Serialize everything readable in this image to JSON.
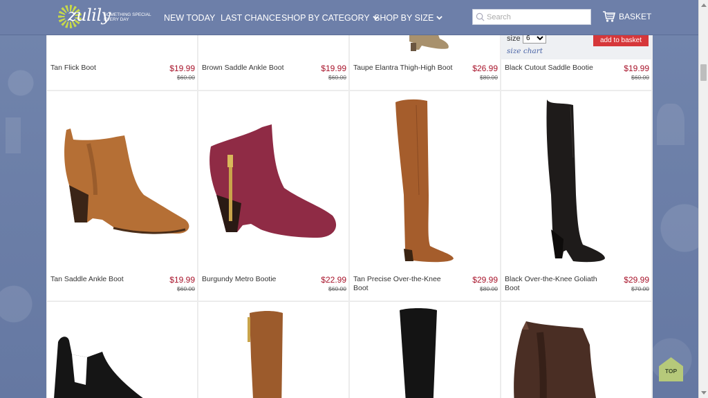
{
  "header": {
    "logo_word": "zulily",
    "logo_tagline": "something special every day",
    "nav": [
      {
        "label": "NEW TODAY",
        "has_dropdown": false
      },
      {
        "label": "LAST CHANCE",
        "has_dropdown": false
      },
      {
        "label": "SHOP BY CATEGORY",
        "has_dropdown": true
      },
      {
        "label": "SHOP BY SIZE",
        "has_dropdown": true
      }
    ],
    "search_placeholder": "Search",
    "basket_label": "BASKET"
  },
  "size_panel": {
    "size_label": "size",
    "selected_size": "6",
    "size_chart_label": "size chart",
    "add_button_label": "add to basket"
  },
  "products": [
    {
      "name": "Tan Flick Boot",
      "price": "$19.99",
      "original_price": "$60.00",
      "shoe": "none",
      "color": "#a5713d"
    },
    {
      "name": "Brown Saddle Ankle Boot",
      "price": "$19.99",
      "original_price": "$60.00",
      "shoe": "none",
      "color": "#8a5a34"
    },
    {
      "name": "Taupe Elantra Thigh-High Boot",
      "price": "$26.99",
      "original_price": "$80.00",
      "shoe": "heel-stub",
      "color": "#a8916d"
    },
    {
      "name": "Black Cutout Saddle Bootie",
      "price": "$19.99",
      "original_price": "$60.00",
      "shoe": "none",
      "color": "#222222"
    },
    {
      "name": "Tan Saddle Ankle Boot",
      "price": "$19.99",
      "original_price": "$60.00",
      "shoe": "ankle",
      "color": "#b56f35"
    },
    {
      "name": "Burgundy Metro Bootie",
      "price": "$22.99",
      "original_price": "$60.00",
      "shoe": "ankle-zip",
      "color": "#8f2b45"
    },
    {
      "name": "Tan Precise Over-the-Knee Boot",
      "price": "$29.99",
      "original_price": "$80.00",
      "shoe": "otk",
      "color": "#a55d2c"
    },
    {
      "name": "Black Over-the-Knee Goliath Boot",
      "price": "$29.99",
      "original_price": "$70.00",
      "shoe": "otk-heel",
      "color": "#1e1b1a"
    },
    {
      "name": "",
      "price": "",
      "original_price": "",
      "shoe": "cutout-black",
      "color": "#151515"
    },
    {
      "name": "",
      "price": "",
      "original_price": "",
      "shoe": "tall-tan",
      "color": "#9c5b2c"
    },
    {
      "name": "",
      "price": "",
      "original_price": "",
      "shoe": "tall-black",
      "color": "#141414"
    },
    {
      "name": "",
      "price": "",
      "original_price": "",
      "shoe": "chelsea",
      "color": "#4a2e24"
    }
  ],
  "top_button_label": "TOP",
  "colors": {
    "header_bg": "#6d7fa9",
    "price_red": "#a8142b",
    "add_button": "#d6373a",
    "top_button": "#b6c97a"
  }
}
